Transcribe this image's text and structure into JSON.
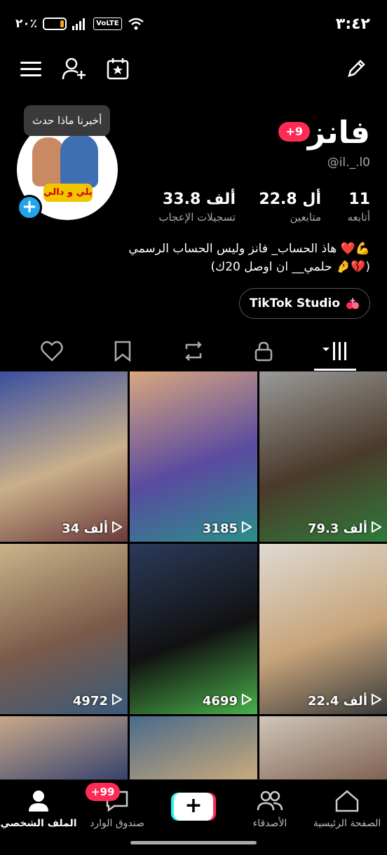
{
  "status_bar": {
    "time": "٣:٤٢",
    "battery": "٢٠٪",
    "battery_level": 0.2,
    "network_badge": "VoLTE",
    "accent": "#f5a623"
  },
  "toolbar": {
    "icons": [
      "menu-icon",
      "add-friend-icon",
      "calendar-star-icon",
      "edit-icon"
    ]
  },
  "profile": {
    "tooltip": "أخبرنا ماذا حدث",
    "avatar_caption": "يلي و دالي",
    "name": "فانز",
    "notification_badge": "+9",
    "handle": "@il._.l0",
    "stats": {
      "following": {
        "value": "11",
        "label": "أتابعه"
      },
      "followers": {
        "value": "22.8 أل",
        "label": "متابعين"
      },
      "likes": {
        "value": "33.8 ألف",
        "label": "تسجيلات الإعجاب"
      }
    },
    "bio_line1": "هاذ الحساب_ فانز وليس الحساب الرسمي ❤️💪",
    "bio_line2": "(حلمي__ ان اوصل 20ك 🤌💔)",
    "studio_button": "TikTok Studio"
  },
  "tabs": {
    "icons": [
      "liked-icon",
      "bookmark-icon",
      "repost-icon",
      "lock-icon",
      "videos-grid-icon"
    ],
    "active": "videos-grid-icon"
  },
  "videos": [
    {
      "views": "79.3 ألف",
      "colors": [
        "#9a9a9a",
        "#4a3a2a",
        "#2f7a3a"
      ]
    },
    {
      "views": "3185",
      "colors": [
        "#d9a77e",
        "#5a4aa0",
        "#2a8f8a"
      ]
    },
    {
      "views": "34 ألف",
      "colors": [
        "#3a4fa0",
        "#c9b08a",
        "#6a3a3a"
      ]
    },
    {
      "views": "22.4 ألف",
      "colors": [
        "#dedad2",
        "#c7a47a",
        "#3a3a3a"
      ]
    },
    {
      "views": "4699",
      "colors": [
        "#2b3a5a",
        "#111111",
        "#4ab04a"
      ]
    },
    {
      "views": "4972",
      "colors": [
        "#c9b48a",
        "#7a5a4a",
        "#3a5a7a"
      ]
    },
    {
      "views": "",
      "colors": [
        "#cfc6b8",
        "#7a5a4a",
        "#6a6a6a"
      ]
    },
    {
      "views": "",
      "colors": [
        "#4a6a8a",
        "#d4b07a",
        "#8a7a6a"
      ]
    },
    {
      "views": "",
      "colors": [
        "#c9a88a",
        "#2a3a6a",
        "#e0e0e0"
      ]
    }
  ],
  "bottom_nav": {
    "home": "الصفحة الرئيسية",
    "friends": "الأصدقاء",
    "create": "+",
    "inbox": "صندوق الوارد",
    "inbox_badge": "+99",
    "profile": "الملف الشخصي"
  },
  "colors": {
    "brand_pink": "#fe2c55",
    "brand_cyan": "#25f4ee",
    "link_blue": "#20a4ea"
  }
}
